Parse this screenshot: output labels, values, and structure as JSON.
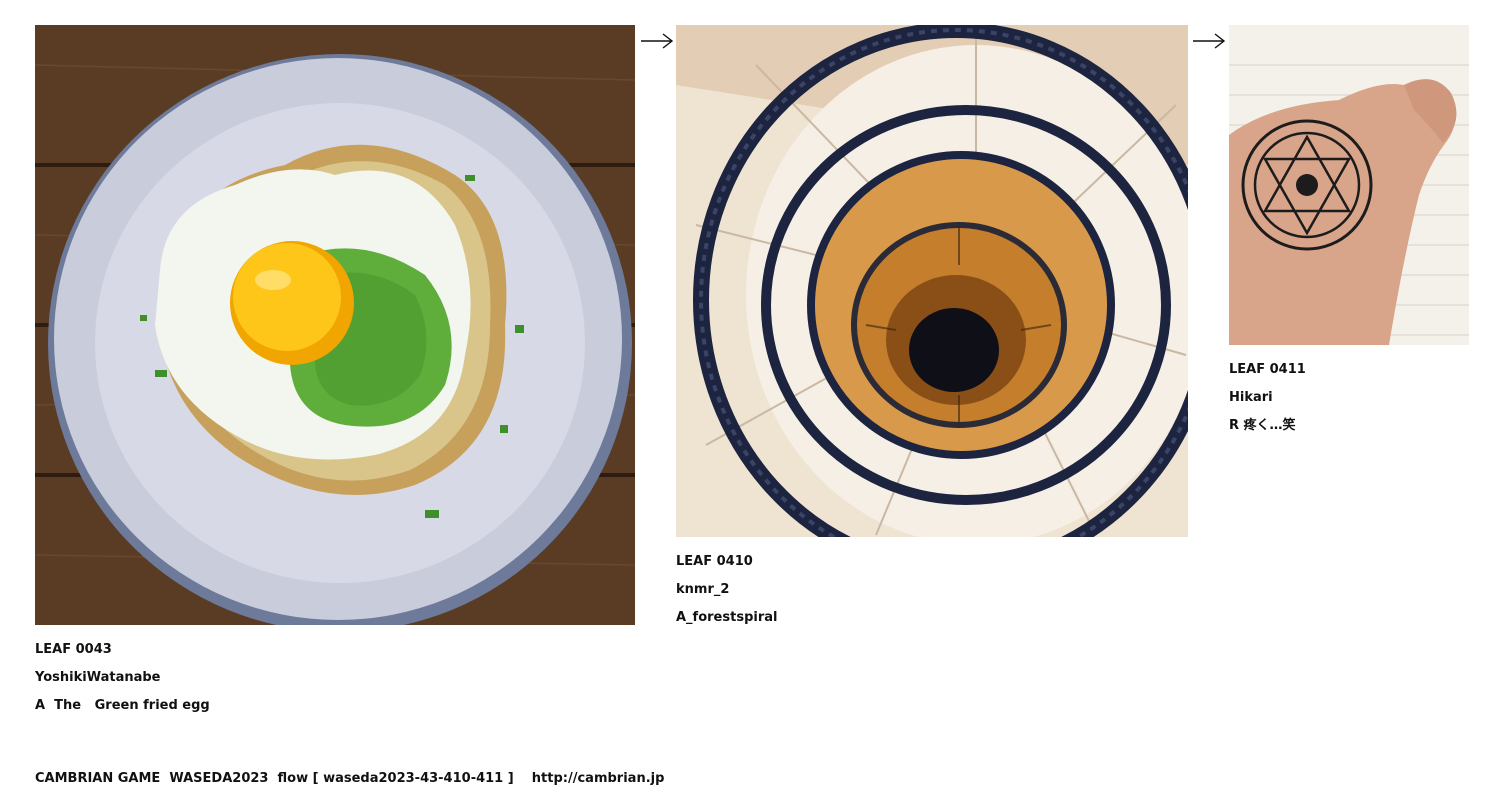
{
  "leaves": [
    {
      "code": "LEAF 0043",
      "author": "YoshikiWatanabe",
      "caption": "A  The   Green fried egg",
      "image": "photo of a green fried egg on a plate"
    },
    {
      "code": "LEAF 0410",
      "author": "knmr_2",
      "caption": "A_forestspiral",
      "image": "spiral staircase seen from above"
    },
    {
      "code": "LEAF 0411",
      "author": "Hikari",
      "caption": "R 疼く…笑",
      "image": "hand with drawn magic circle"
    }
  ],
  "arrows": [
    "arrow-right-icon",
    "arrow-right-icon"
  ],
  "footer": {
    "text": "CAMBRIAN GAME  WASEDA2023  flow [ waseda2023-43-410-411 ]    http://cambrian.jp"
  },
  "colors": {
    "text": "#111111",
    "background": "#ffffff"
  }
}
